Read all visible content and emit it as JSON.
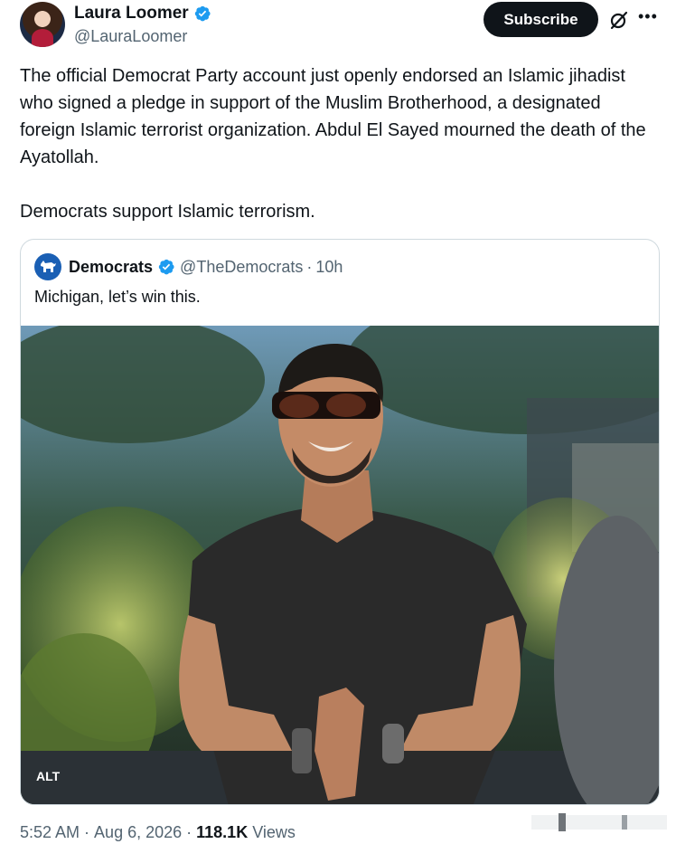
{
  "author": {
    "display_name": "Laura Loomer",
    "handle": "@LauraLoomer",
    "avatar_icon": "avatar",
    "verified_icon": "verified-badge-icon"
  },
  "actions": {
    "subscribe_label": "Subscribe",
    "grok_icon": "grok-icon",
    "more_icon": "more-icon"
  },
  "tweet": {
    "paragraph_1": "The official Democrat Party account just openly endorsed an Islamic jihadist who signed a pledge in support of the Muslim Brotherhood, a designated foreign Islamic terrorist organization. Abdul El Sayed mourned the death of the Ayatollah.",
    "paragraph_2": "Democrats support Islamic terrorism."
  },
  "quoted": {
    "display_name": "Democrats",
    "handle": "@TheDemocrats",
    "separator": "·",
    "time": "10h",
    "text": "Michigan, let’s win this.",
    "alt_label": "ALT"
  },
  "footer": {
    "time": "5:52 AM",
    "separator_1": "·",
    "date": "Aug 6, 2026",
    "separator_2": "·",
    "views_count": "118.1K",
    "views_label": "Views"
  },
  "colors": {
    "accent": "#1d9bf0",
    "text": "#0f1419",
    "secondary": "#536471",
    "border": "#cfd9de"
  }
}
